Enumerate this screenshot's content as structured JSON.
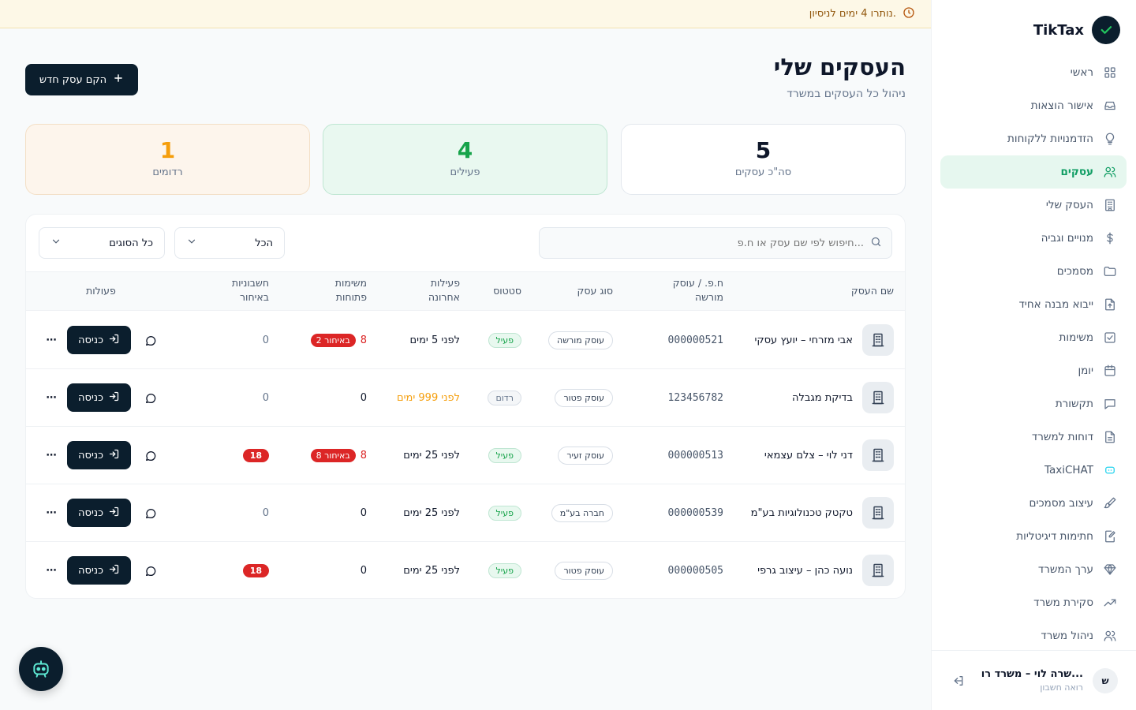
{
  "app": {
    "name": "TikTax"
  },
  "trial": {
    "text": "נותרו 4 ימים לניסיון."
  },
  "sidebar": {
    "items": [
      {
        "label": "ראשי",
        "icon": "grid-icon"
      },
      {
        "label": "אישור הוצאות",
        "icon": "inbox-icon"
      },
      {
        "label": "הזדמנויות ללקוחות",
        "icon": "lightbulb-icon"
      },
      {
        "label": "עסקים",
        "icon": "users-icon",
        "active": true
      },
      {
        "label": "העסק שלי",
        "icon": "building-icon"
      },
      {
        "label": "מנויים וגביה",
        "icon": "dollar-icon"
      },
      {
        "label": "מסמכים",
        "icon": "folder-icon"
      },
      {
        "label": "ייבוא מבנה אחיד",
        "icon": "file-upload-icon"
      },
      {
        "label": "משימות",
        "icon": "checkbox-icon"
      },
      {
        "label": "יומן",
        "icon": "calendar-icon"
      },
      {
        "label": "תקשורת",
        "icon": "message-icon"
      },
      {
        "label": "דוחות למשרד",
        "icon": "report-icon"
      },
      {
        "label": "TaxiCHAT",
        "icon": "bot-icon"
      },
      {
        "label": "עיצוב מסמכים",
        "icon": "brush-icon"
      },
      {
        "label": "חתימות דיגיטליות",
        "icon": "signature-icon"
      },
      {
        "label": "ערך המשרד",
        "icon": "diamond-icon"
      },
      {
        "label": "סקירת משרד",
        "icon": "trend-icon"
      },
      {
        "label": "ניהול משרד",
        "icon": "team-icon"
      }
    ]
  },
  "user": {
    "initial": "ש",
    "name": "שרה לוי – משרד רו...",
    "role": "רואה חשבון"
  },
  "page": {
    "title": "העסקים שלי",
    "subtitle": "ניהול כל העסקים במשרד",
    "new_button": "הקם עסק חדש"
  },
  "stats": {
    "total": {
      "value": "5",
      "label": "סה\"כ עסקים"
    },
    "active": {
      "value": "4",
      "label": "פעילים"
    },
    "dormant": {
      "value": "1",
      "label": "רדומים"
    }
  },
  "filters": {
    "search_placeholder": "חיפוש לפי שם עסק או ח.פ...",
    "status_value": "הכל",
    "type_value": "כל הסוגים"
  },
  "table": {
    "headers": {
      "name": "שם העסק",
      "id": "ח.פ. / עוסק מורשה",
      "type": "סוג עסק",
      "status": "סטטוס",
      "activity": "פעילות אחרונה",
      "tasks": "משימות פתוחות",
      "invoices": "חשבוניות באיחור",
      "actions": "פעולות"
    },
    "enter_label": "כניסה",
    "more_label": "⋯",
    "rows": [
      {
        "name": "אבי מזרחי – יועץ עסקי",
        "id": "000000521",
        "type": "עוסק מורשה",
        "status": "פעיל",
        "activity": "לפני 5 ימים",
        "tasks": "8",
        "late": "2 באיחור",
        "invoices": "0"
      },
      {
        "name": "בדיקת מגבלה",
        "id": "123456782",
        "type": "עוסק פטור",
        "status": "רדום",
        "activity": "לפני 999 ימים",
        "tasks": "0",
        "late": "",
        "invoices": "0"
      },
      {
        "name": "דני לוי – צלם עצמאי",
        "id": "000000513",
        "type": "עוסק זעיר",
        "status": "פעיל",
        "activity": "לפני 25 ימים",
        "tasks": "8",
        "late": "8 באיחור",
        "invoices": "18"
      },
      {
        "name": "טקטק טכנולוגיות בע\"מ",
        "id": "000000539",
        "type": "חברה בע\"מ",
        "status": "פעיל",
        "activity": "לפני 25 ימים",
        "tasks": "0",
        "late": "",
        "invoices": "0"
      },
      {
        "name": "נועה כהן – עיצוב גרפי",
        "id": "000000505",
        "type": "עוסק פטור",
        "status": "פעיל",
        "activity": "לפני 25 ימים",
        "tasks": "0",
        "late": "",
        "invoices": "18"
      }
    ]
  },
  "colors": {
    "brand": "#0b1e2d",
    "accent": "#0f9d63",
    "danger": "#dc2626",
    "warning": "#f59e0b"
  }
}
